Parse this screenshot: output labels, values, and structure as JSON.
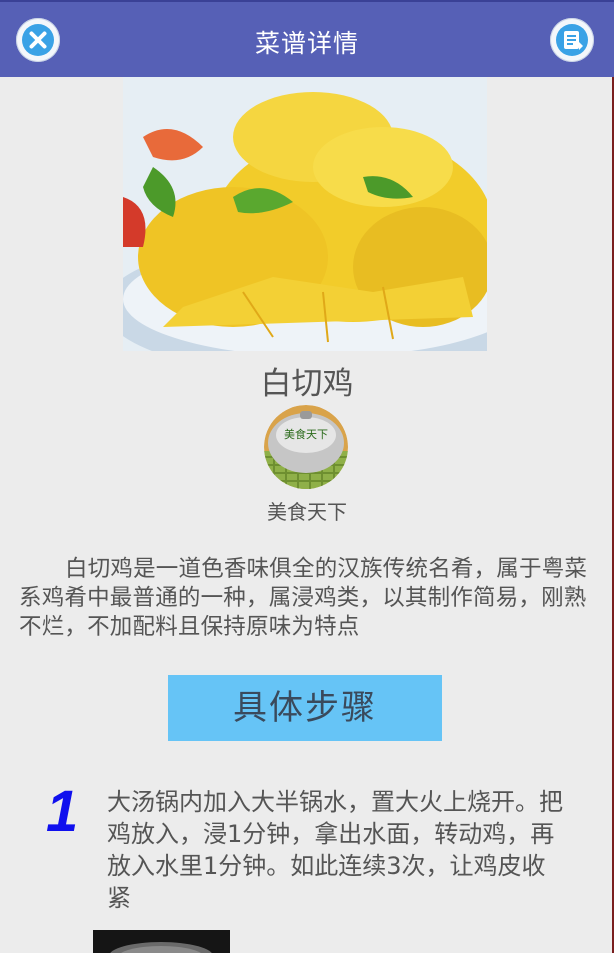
{
  "header": {
    "title": "菜谱详情",
    "close_icon": "close-circle-icon",
    "menu_icon": "menu-list-icon"
  },
  "recipe": {
    "name": "白切鸡",
    "author": "美食天下",
    "logo_text": "美食天下",
    "description": "白切鸡是一道色香味俱全的汉族传统名肴，属于粤菜系鸡肴中最普通的一种，属浸鸡类，以其制作简易，刚熟不烂，不加配料且保持原味为特点"
  },
  "steps_button": {
    "label": "具体步骤"
  },
  "steps": [
    {
      "number": "1",
      "text": "大汤锅内加入大半锅水，置大火上烧开。把鸡放入，浸1分钟，拿出水面，转动鸡，再放入水里1分钟。如此连续3次，让鸡皮收紧"
    }
  ],
  "colors": {
    "header_bg": "#5660b6",
    "page_bg": "#ececec",
    "button_bg": "#66c4f6",
    "step_number": "#1010ee"
  }
}
